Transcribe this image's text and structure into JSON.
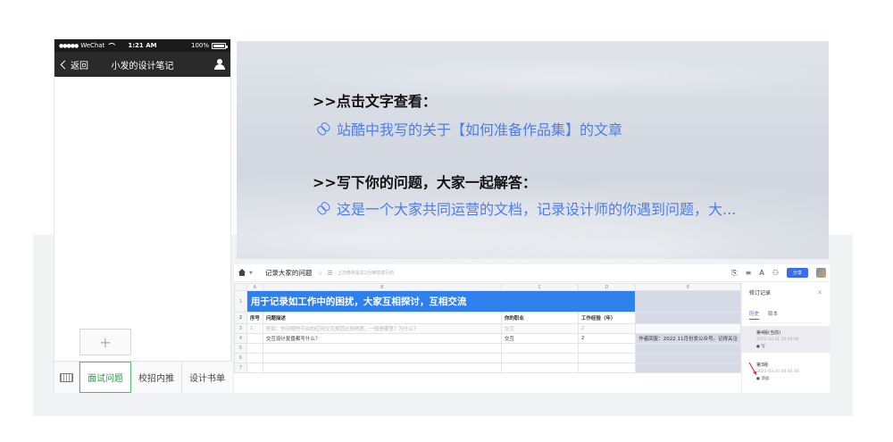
{
  "phone": {
    "status": {
      "carrier": "WeChat",
      "time": "1:21 AM",
      "battery": "100%"
    },
    "nav": {
      "back_label": "返回",
      "title": "小发的设计笔记"
    },
    "add_button_label": "+",
    "menu": {
      "tabs": [
        "面试问题",
        "校招内推",
        "设计书单"
      ],
      "active_index": 0
    }
  },
  "banner": {
    "heading1": ">>点击文字查看：",
    "link1": "站酷中我写的关于【如何准备作品集】的文章",
    "heading2": ">>写下你的问题，大家一起解答：",
    "link2": "这是一个大家共同运营的文档，记录设计师的你遇到问题，大..."
  },
  "sheet": {
    "doc_title": "记录大家的问题",
    "save_status": "上次修改是在2分钟前进行的",
    "share_label": "分享",
    "columns": [
      "A",
      "B",
      "C",
      "D",
      "E"
    ],
    "title_text": "用于记录如工作中的困扰，大家互相探讨，互相交流",
    "header": [
      "序号",
      "问题描述",
      "你的职业",
      "工作经验（年）"
    ],
    "rows": [
      {
        "num": "3",
        "cells": [
          "1",
          "例如：你对哪些平台的应用交互规范比较熟悉，一般是哪里？为什么？",
          "交互",
          "2"
        ],
        "sample": true
      },
      {
        "num": "4",
        "cells": [
          "",
          "交互设计复盘都写什么？",
          "交互",
          "2"
        ],
        "note": "作者回复：2022 11月份发公众号。记得关注"
      },
      {
        "num": "5",
        "cells": [
          "",
          "",
          "",
          ""
        ]
      },
      {
        "num": "6",
        "cells": [
          "",
          "",
          "",
          ""
        ]
      },
      {
        "num": "7",
        "cells": [
          "",
          "",
          "",
          ""
        ]
      }
    ],
    "revision": {
      "title": "修订记录",
      "tabs": [
        "历史",
        "版本"
      ],
      "entries": [
        {
          "name": "第4版(当前)",
          "time": "2022-10-31 20:04:04",
          "user": "● 写",
          "selected": true
        },
        {
          "name": "第3版",
          "time": "2022-03-30 00:46:40",
          "user": "● 添加",
          "selected": false
        }
      ]
    }
  },
  "colors": {
    "accent_blue": "#2f80ed",
    "link_blue": "#4c7ee8",
    "green_active": "#53b96e",
    "nav_dark": "#2a2a2a"
  }
}
